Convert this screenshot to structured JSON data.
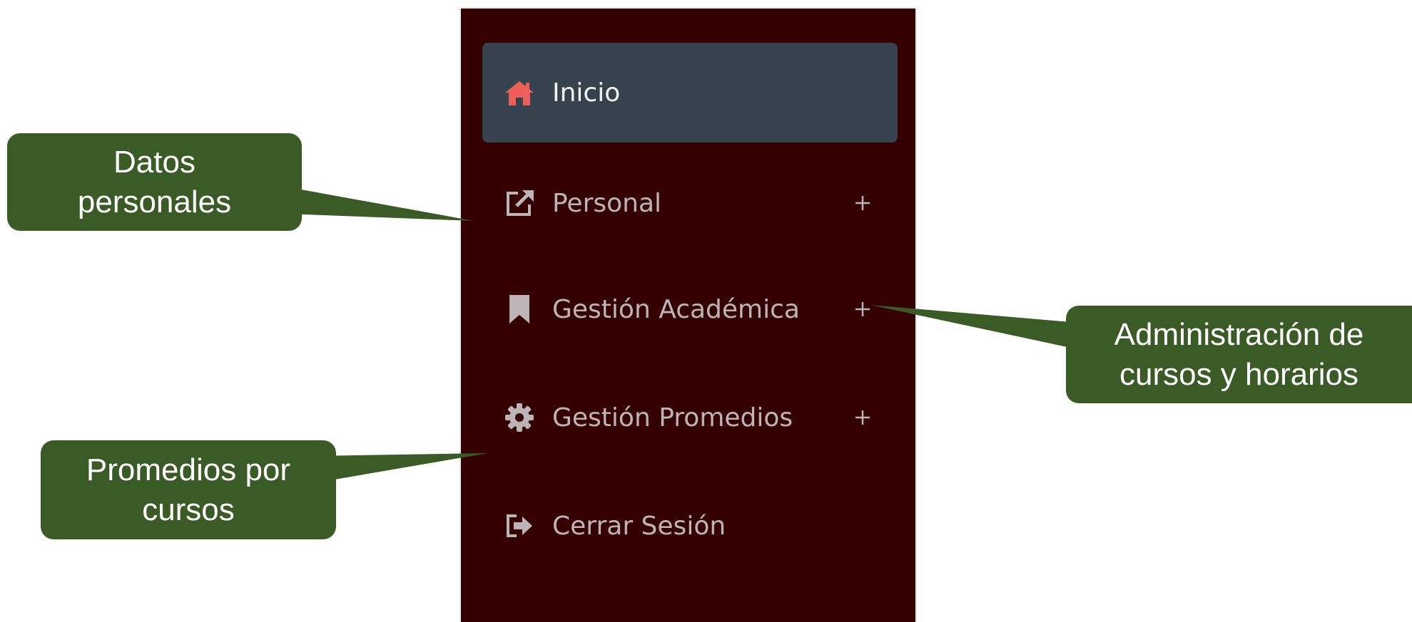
{
  "sidebar": {
    "items": [
      {
        "label": "Inicio",
        "icon": "home-icon",
        "active": true,
        "expandable": false
      },
      {
        "label": "Personal",
        "icon": "external-link-icon",
        "active": false,
        "expandable": true
      },
      {
        "label": "Gestión Académica",
        "icon": "bookmark-icon",
        "active": false,
        "expandable": true
      },
      {
        "label": "Gestión Promedios",
        "icon": "gear-icon",
        "active": false,
        "expandable": true
      },
      {
        "label": "Cerrar Sesión",
        "icon": "sign-out-icon",
        "active": false,
        "expandable": false
      }
    ]
  },
  "callouts": [
    {
      "text": "Datos personales",
      "line1": "Datos",
      "line2": "personales"
    },
    {
      "text": "Administración de cursos y horarios",
      "line1": "Administración de",
      "line2": "cursos y horarios"
    },
    {
      "text": "Promedios por cursos",
      "line1": "Promedios por",
      "line2": "cursos"
    }
  ],
  "colors": {
    "sidebar_bg": "#340000",
    "active_item_bg": "#37424f",
    "home_icon": "#ef5f5a",
    "menu_text": "#bdb4b8",
    "callout_bg": "#3a5a26"
  }
}
